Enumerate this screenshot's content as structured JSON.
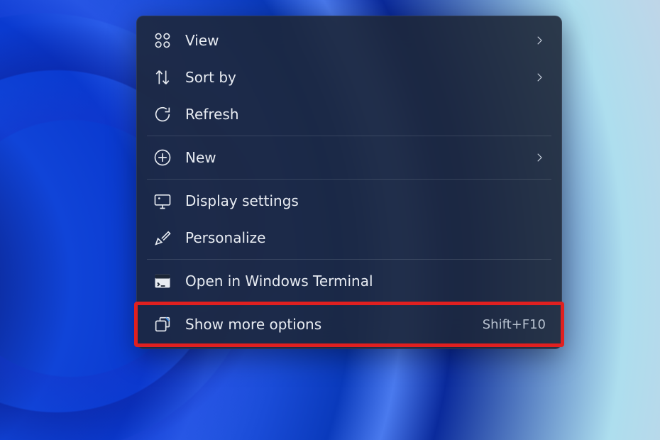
{
  "menu": {
    "groups": [
      [
        {
          "id": "view",
          "label": "View",
          "icon": "grid-icon",
          "submenu": true
        },
        {
          "id": "sortby",
          "label": "Sort by",
          "icon": "sort-icon",
          "submenu": true
        },
        {
          "id": "refresh",
          "label": "Refresh",
          "icon": "refresh-icon",
          "submenu": false
        }
      ],
      [
        {
          "id": "new",
          "label": "New",
          "icon": "new-icon",
          "submenu": true
        }
      ],
      [
        {
          "id": "display",
          "label": "Display settings",
          "icon": "display-icon",
          "submenu": false
        },
        {
          "id": "personalize",
          "label": "Personalize",
          "icon": "personalize-icon",
          "submenu": false
        }
      ],
      [
        {
          "id": "terminal",
          "label": "Open in Windows Terminal",
          "icon": "terminal-icon",
          "submenu": false
        }
      ],
      [
        {
          "id": "more",
          "label": "Show more options",
          "icon": "more-options-icon",
          "submenu": false,
          "shortcut": "Shift+F10",
          "highlighted": true
        }
      ]
    ]
  }
}
